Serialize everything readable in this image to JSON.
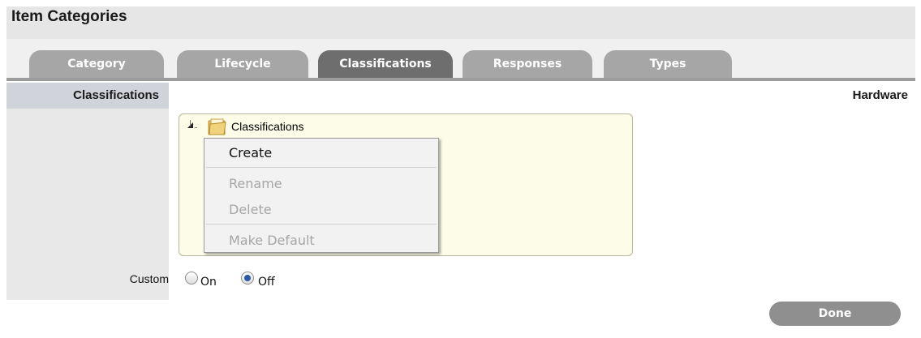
{
  "page": {
    "title": "Item Categories"
  },
  "tabs": [
    {
      "label": "Category",
      "active": false
    },
    {
      "label": "Lifecycle",
      "active": false
    },
    {
      "label": "Classifications",
      "active": true
    },
    {
      "label": "Responses",
      "active": false
    },
    {
      "label": "Types",
      "active": false
    }
  ],
  "section": {
    "label": "Classifications",
    "context": "Hardware"
  },
  "tree": {
    "root_label": "Classifications",
    "expander_icon": "tree-expand-icon",
    "root_icon": "folder-icon"
  },
  "context_menu": {
    "items": [
      {
        "label": "Create",
        "enabled": true
      },
      {
        "label": "Rename",
        "enabled": false
      },
      {
        "label": "Delete",
        "enabled": false
      },
      {
        "label": "Make Default",
        "enabled": false
      }
    ]
  },
  "custom": {
    "label": "Custom",
    "options": [
      {
        "label": "On",
        "selected": false
      },
      {
        "label": "Off",
        "selected": true
      }
    ]
  },
  "actions": {
    "done_label": "Done"
  },
  "colors": {
    "tab_inactive": "#a6a6a6",
    "tab_active": "#6e6e6e",
    "tree_background": "#fcfce8",
    "radio_selected": "#2c5aa6",
    "done_button": "#8f8f8f"
  }
}
